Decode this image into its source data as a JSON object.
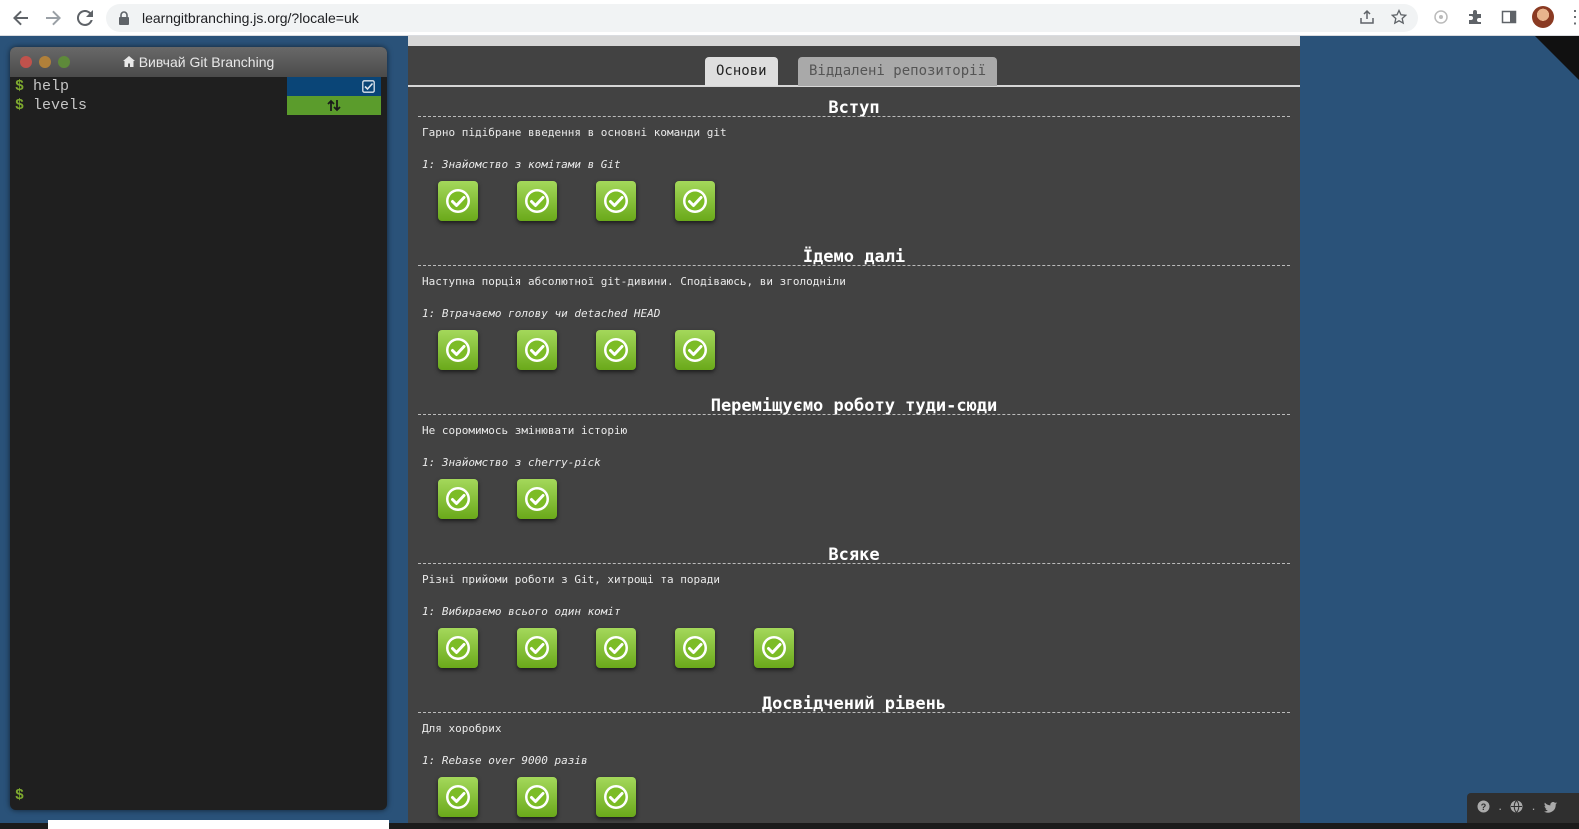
{
  "browser": {
    "url": "learngitbranching.js.org/?locale=uk"
  },
  "terminal": {
    "title": "Вивчай Git Branching",
    "commands": [
      {
        "text": "help"
      },
      {
        "text": "levels"
      }
    ],
    "prompt": "$"
  },
  "tabs": [
    {
      "label": "Основи",
      "active": true
    },
    {
      "label": "Віддалені репозиторії",
      "active": false
    }
  ],
  "sequences": [
    {
      "title": "Вступ",
      "description": "Гарно підібране введення в основні команди git",
      "subtitle": "1: Знайомство з комітами в Git",
      "levels": 4
    },
    {
      "title": "Їдемо далі",
      "description": "Наступна порція абсолютної git-дивини. Сподіваюсь, ви зголодніли",
      "subtitle": "1: Втрачаємо голову чи detached HEAD",
      "levels": 4
    },
    {
      "title": "Переміщуємо роботу туди-сюди",
      "description": "Не соромимось змінювати історію",
      "subtitle": "1: Знайомство з cherry-pick",
      "levels": 2
    },
    {
      "title": "Всяке",
      "description": "Різні прийоми роботи з Git, хитрощі та поради",
      "subtitle": "1: Вибираємо всього один коміт",
      "levels": 5
    },
    {
      "title": "Досвідчений рівень",
      "description": "Для хоробрих",
      "subtitle": "1: Rebase over 9000 разів",
      "levels": 3
    }
  ],
  "colors": {
    "page_bg": "#2a5279",
    "dialog_bg": "#424242",
    "level_complete": "#6aa91a",
    "help_badge": "#0a4577",
    "levels_badge": "#5b9c2c"
  }
}
